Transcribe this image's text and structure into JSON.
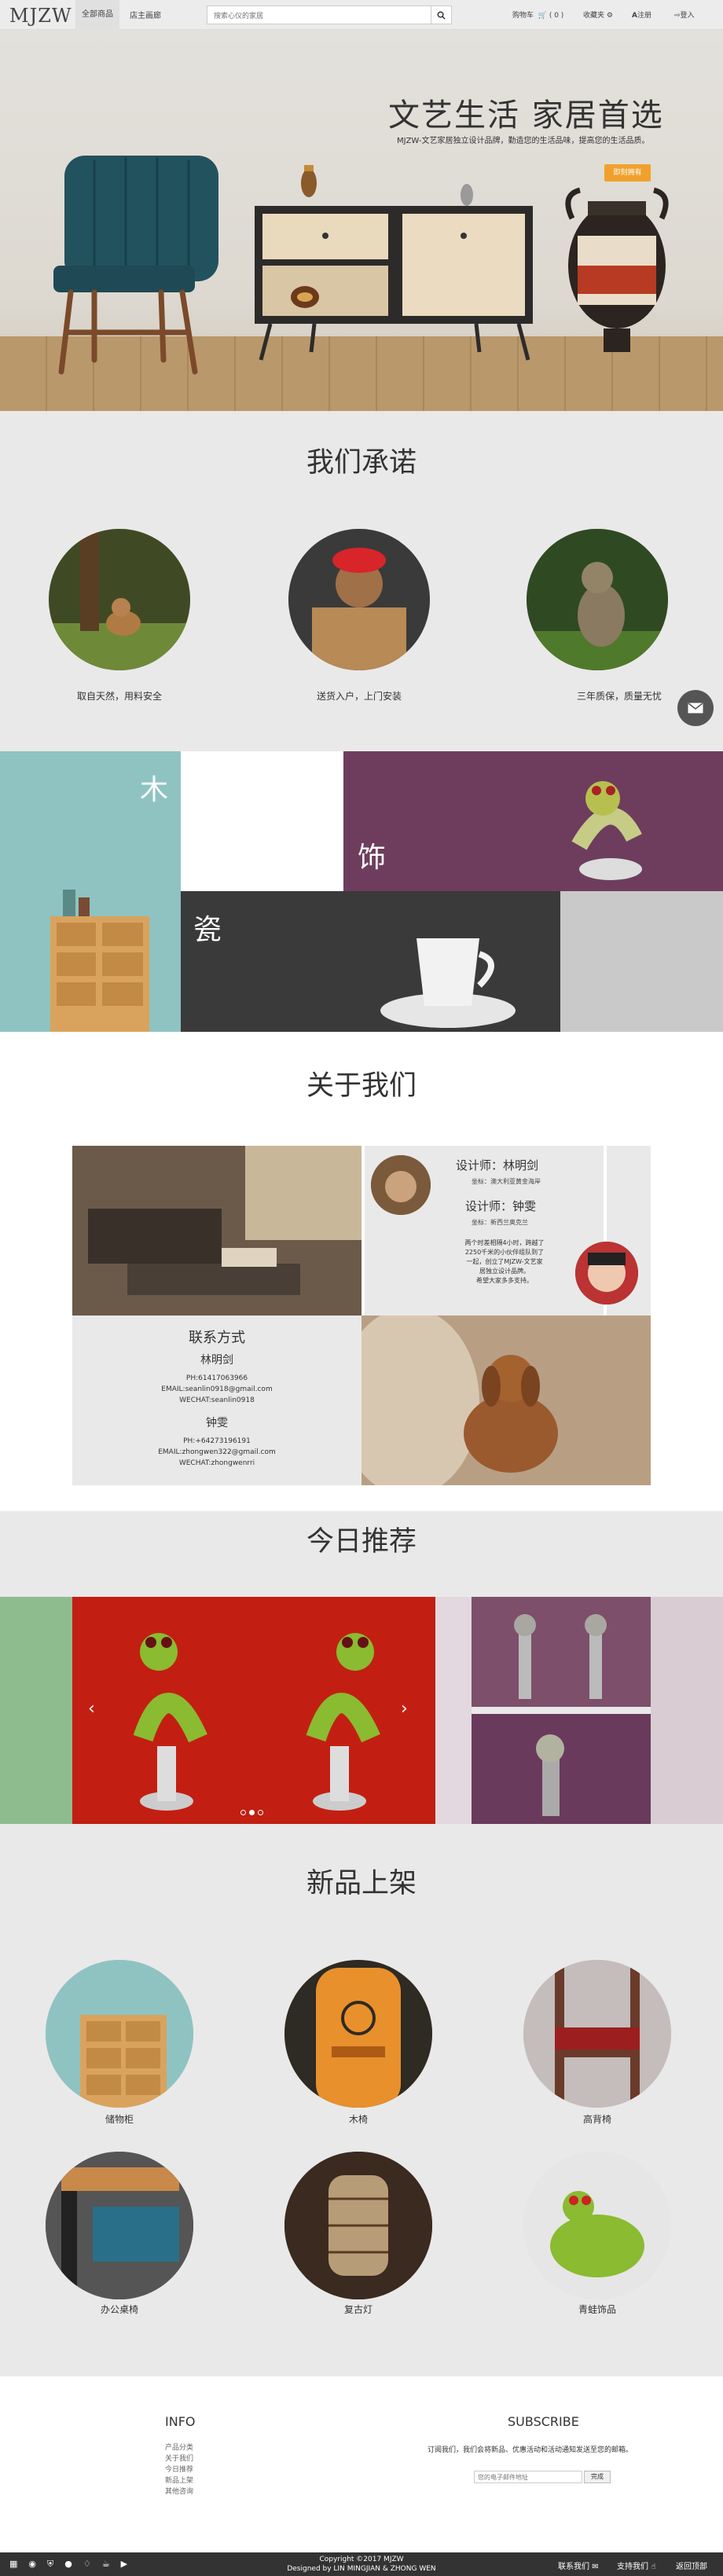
{
  "header": {
    "logo": "MJZW",
    "nav": [
      "全部商品",
      "店主画廊"
    ],
    "search_placeholder": "搜索心仪的家居",
    "cart": "购物车",
    "cart_count": "( 0 )",
    "favorites": "收藏夹",
    "register": "注册",
    "login": "登入"
  },
  "hero": {
    "title": "文艺生活 家居首选",
    "subtitle": "MJZW-文艺家居独立设计品牌，勤造您的生活品味，提高您的生活品质。",
    "cta": "即刻拥有"
  },
  "promise": {
    "title": "我们承诺",
    "items": [
      "取自天然，用料安全",
      "送货入户，上门安装",
      "三年质保，质量无忧"
    ]
  },
  "categories": {
    "wood": "木",
    "decor": "饰",
    "ceramic": "瓷"
  },
  "about": {
    "title": "关于我们",
    "designer1": "设计师：林明剑",
    "designer1_addr": "坐标：澳大利亚黄金海岸",
    "designer2": "设计师：钟雯",
    "designer2_addr": "坐标：新西兰奥克兰",
    "story": [
      "两个时差相隔4小时，跨越了",
      "2250千米的小伙伴组队到了",
      "一起，创立了MJZW-文艺家",
      "居独立设计品牌。",
      "希望大家多多支持。"
    ],
    "contact_title": "联系方式",
    "contact1_name": "林明剑",
    "contact1_ph": "PH:61417063966",
    "contact1_email": "EMAIL:seanlin0918@gmail.com",
    "contact1_wechat": "WECHAT:seanlin0918",
    "contact2_name": "钟雯",
    "contact2_ph": "PH:+64273196191",
    "contact2_email": "EMAIL:zhongwen322@gmail.com",
    "contact2_wechat": "WECHAT:zhongwenrri"
  },
  "recommend": {
    "title": "今日推荐",
    "dots": 3,
    "active_dot": 1
  },
  "new_products": {
    "title": "新品上架",
    "items": [
      "储物柜",
      "木椅",
      "高背椅",
      "办公桌椅",
      "复古灯",
      "青蛙饰品"
    ]
  },
  "footer": {
    "info_title": "INFO",
    "info_links": [
      "产品分类",
      "关于我们",
      "今日推荐",
      "新品上架",
      "其他咨询"
    ],
    "subscribe_title": "SUBSCRIBE",
    "subscribe_text": "订阅我们，我们会将新品、优惠活动和活动通知发送至您的邮箱。",
    "email_placeholder": "您的电子邮件地址",
    "subscribe_btn": "完成",
    "copyright": "Copyright ©2017 MJZW",
    "designed_by": "Designed by LIN MINGJIAN & ZHONG WEN",
    "contact_us": "联系我们",
    "support_us": "支持我们",
    "back_top": "返回顶部"
  },
  "colors": {
    "accent": "#f0a12c",
    "purple": "#6e3d5e",
    "dark": "#333333",
    "teal": "#8fc3c1"
  }
}
